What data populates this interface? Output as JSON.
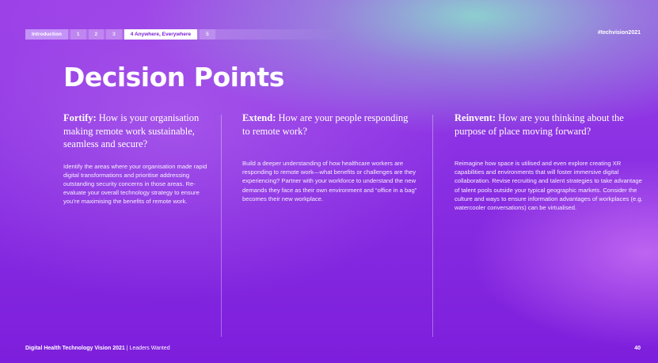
{
  "nav": {
    "items": [
      {
        "label": "Introduction"
      },
      {
        "label": "1"
      },
      {
        "label": "2"
      },
      {
        "label": "3"
      },
      {
        "label": "4 Anywhere, Everywhere"
      },
      {
        "label": "5"
      }
    ],
    "active_index": 4
  },
  "hashtag": "#techvision2021",
  "title": "Decision Points",
  "columns": [
    {
      "lead": "Fortify:",
      "question": "How is your organisation making remote work sustainable, seamless and secure?",
      "body": "Identify the areas where your organisation made rapid digital transformations and prioritise addressing outstanding security concerns in those areas. Re-evaluate your overall technology strategy to ensure you’re maximising the benefits of remote work."
    },
    {
      "lead": "Extend:",
      "question": "How are your people responding to remote work?",
      "body": "Build a deeper understanding of how healthcare workers are responding to remote work—what benefits or challenges are they experiencing? Partner with your workforce to understand the new demands they face as their own environment and “office in a bag” becomes their new workplace."
    },
    {
      "lead": "Reinvent:",
      "question": "How are you thinking about the purpose of place moving forward?",
      "body": "Reimagine how space is utilised and even explore creating XR capabilities and environments that will foster immersive digital collaboration. Revise recruiting and talent strategies to take advantage of talent pools outside your typical geographic markets. Consider the culture and ways to ensure information advantages of workplaces (e.g. watercooler conversations) can be virtualised."
    }
  ],
  "footer": {
    "report_title": "Digital Health Technology Vision 2021",
    "separator": " | ",
    "subtitle": "Leaders Wanted",
    "page_number": "40"
  },
  "colors": {
    "background_primary": "#8a30e3",
    "background_highlight": "#8cd6ce",
    "active_tab_text": "#7a1fd9",
    "text": "#ffffff"
  }
}
